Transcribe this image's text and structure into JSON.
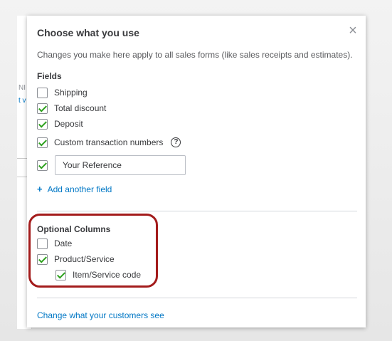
{
  "background": {
    "fragments": [
      "NI",
      "t v"
    ]
  },
  "panel": {
    "title": "Choose what you use",
    "close_glyph": "×",
    "description": "Changes you make here apply to all sales forms (like sales receipts and estimates).",
    "fields_section": {
      "label": "Fields",
      "items": [
        {
          "label": "Shipping",
          "checked": false
        },
        {
          "label": "Total discount",
          "checked": true
        },
        {
          "label": "Deposit",
          "checked": true
        },
        {
          "label": "Custom transaction numbers",
          "checked": true,
          "help_glyph": "?"
        }
      ],
      "custom_field": {
        "checked": true,
        "value": "Your Reference"
      },
      "add_field_icon": "+",
      "add_field_label": "Add another field"
    },
    "optional_columns": {
      "label": "Optional Columns",
      "items": [
        {
          "label": "Date",
          "checked": false
        },
        {
          "label": "Product/Service",
          "checked": true
        },
        {
          "label": "Item/Service code",
          "checked": true
        }
      ]
    },
    "footer_link": "Change what your customers see"
  },
  "colors": {
    "check_green": "#2ca01c",
    "link_blue": "#0077c5",
    "highlight_red": "#a31b1b",
    "text_dark": "#393a3d"
  }
}
